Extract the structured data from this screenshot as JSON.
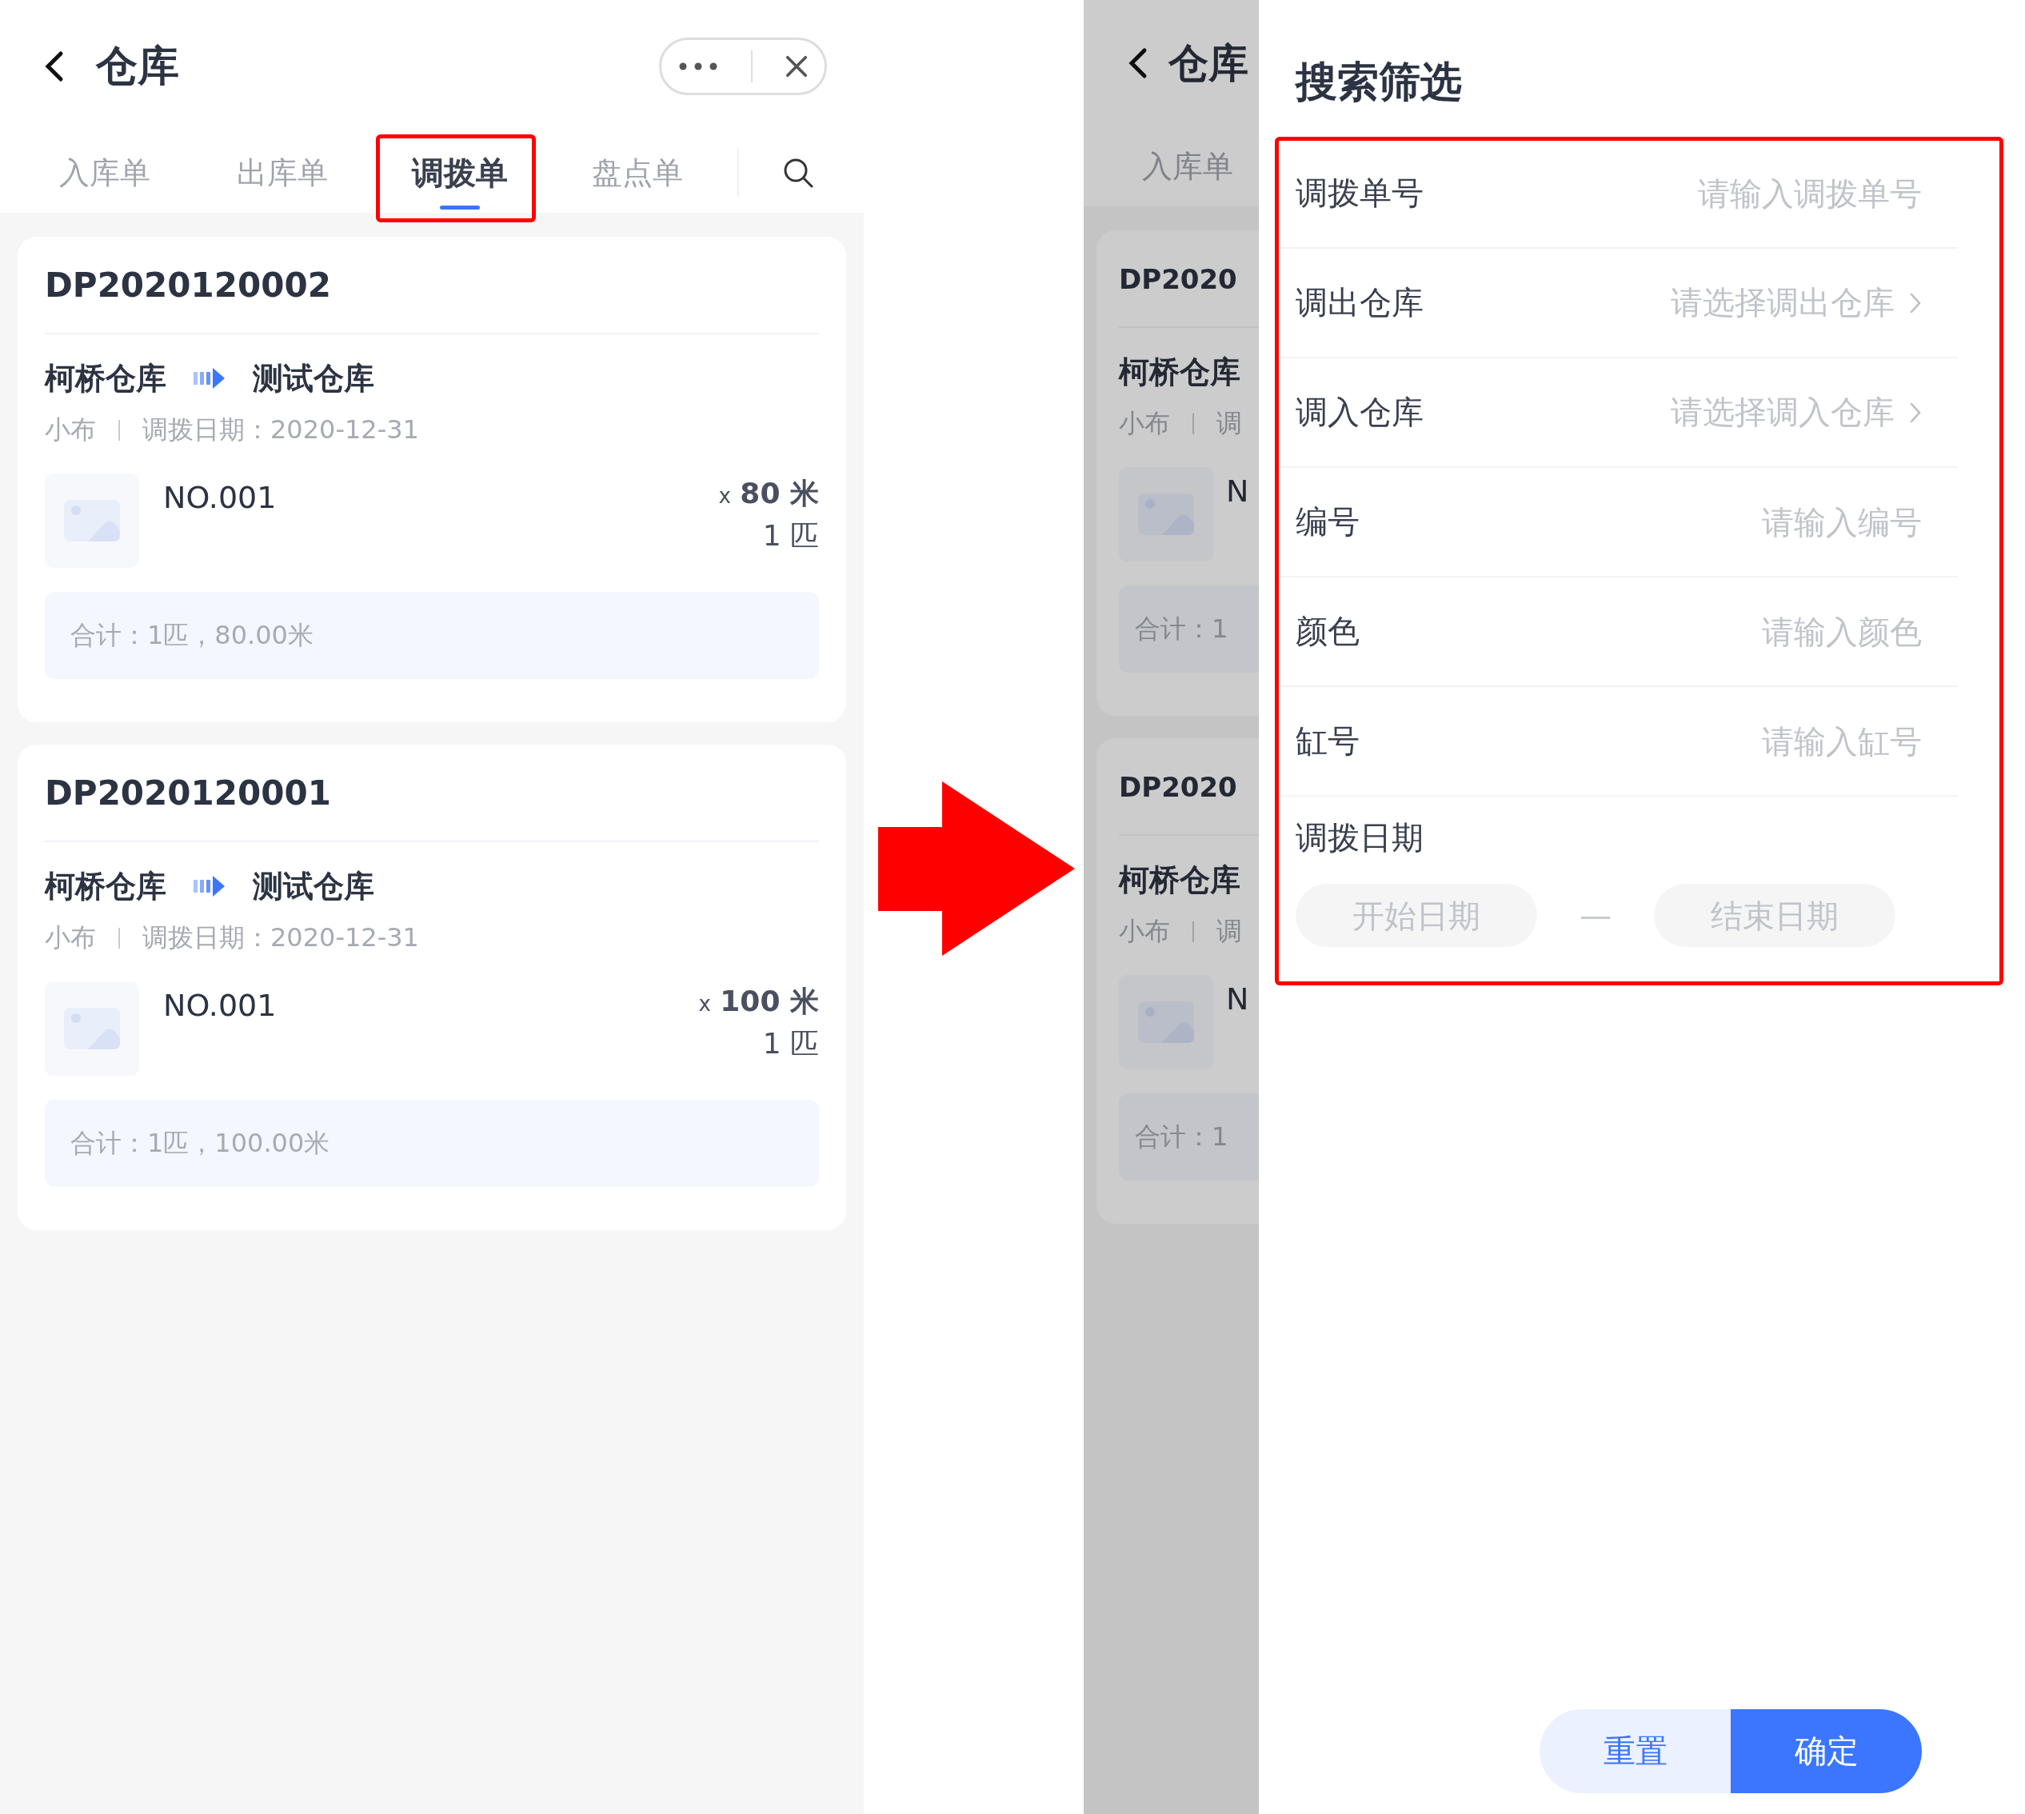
{
  "left_screen": {
    "title": "仓库",
    "tabs": [
      {
        "label": "入库单",
        "selected": false
      },
      {
        "label": "出库单",
        "selected": false
      },
      {
        "label": "调拨单",
        "selected": true
      },
      {
        "label": "盘点单",
        "selected": false
      }
    ],
    "orders": [
      {
        "order_no": "DP2020120002",
        "from": "柯桥仓库",
        "to": "测试仓库",
        "staff": "小布",
        "date": "调拨日期：2020-12-31",
        "item": {
          "name": "NO.001",
          "qty_prefix": "x",
          "qty": "80 米",
          "pieces": "1 匹"
        },
        "total": "合计：1匹，80.00米"
      },
      {
        "order_no": "DP2020120001",
        "from": "柯桥仓库",
        "to": "测试仓库",
        "staff": "小布",
        "date": "调拨日期：2020-12-31",
        "item": {
          "name": "NO.001",
          "qty_prefix": "x",
          "qty": "100 米",
          "pieces": "1 匹"
        },
        "total": "合计：1匹，100.00米"
      }
    ]
  },
  "background_screen": {
    "title": "仓库",
    "tab": "入库单",
    "orders": [
      {
        "order_no": "DP2020",
        "from": "柯桥仓库",
        "staff": "小布",
        "date": "调",
        "item_name": "N",
        "total": "合计：1"
      },
      {
        "order_no": "DP2020",
        "from": "柯桥仓库",
        "staff": "小布",
        "date": "调",
        "item_name": "N",
        "total": "合计：1"
      }
    ]
  },
  "filter_drawer": {
    "title": "搜索筛选",
    "fields": [
      {
        "kind": "input",
        "label": "调拨单号",
        "placeholder": "请输入调拨单号"
      },
      {
        "kind": "select",
        "label": "调出仓库",
        "placeholder": "请选择调出仓库"
      },
      {
        "kind": "select",
        "label": "调入仓库",
        "placeholder": "请选择调入仓库"
      },
      {
        "kind": "input",
        "label": "编号",
        "placeholder": "请输入编号"
      },
      {
        "kind": "input",
        "label": "颜色",
        "placeholder": "请输入颜色"
      },
      {
        "kind": "input",
        "label": "缸号",
        "placeholder": "请输入缸号"
      }
    ],
    "date": {
      "label": "调拨日期",
      "start_placeholder": "开始日期",
      "separator": "—",
      "end_placeholder": "结束日期"
    },
    "buttons": [
      {
        "kind": "secondary",
        "label": "重置"
      },
      {
        "kind": "primary",
        "label": "确定"
      }
    ]
  }
}
